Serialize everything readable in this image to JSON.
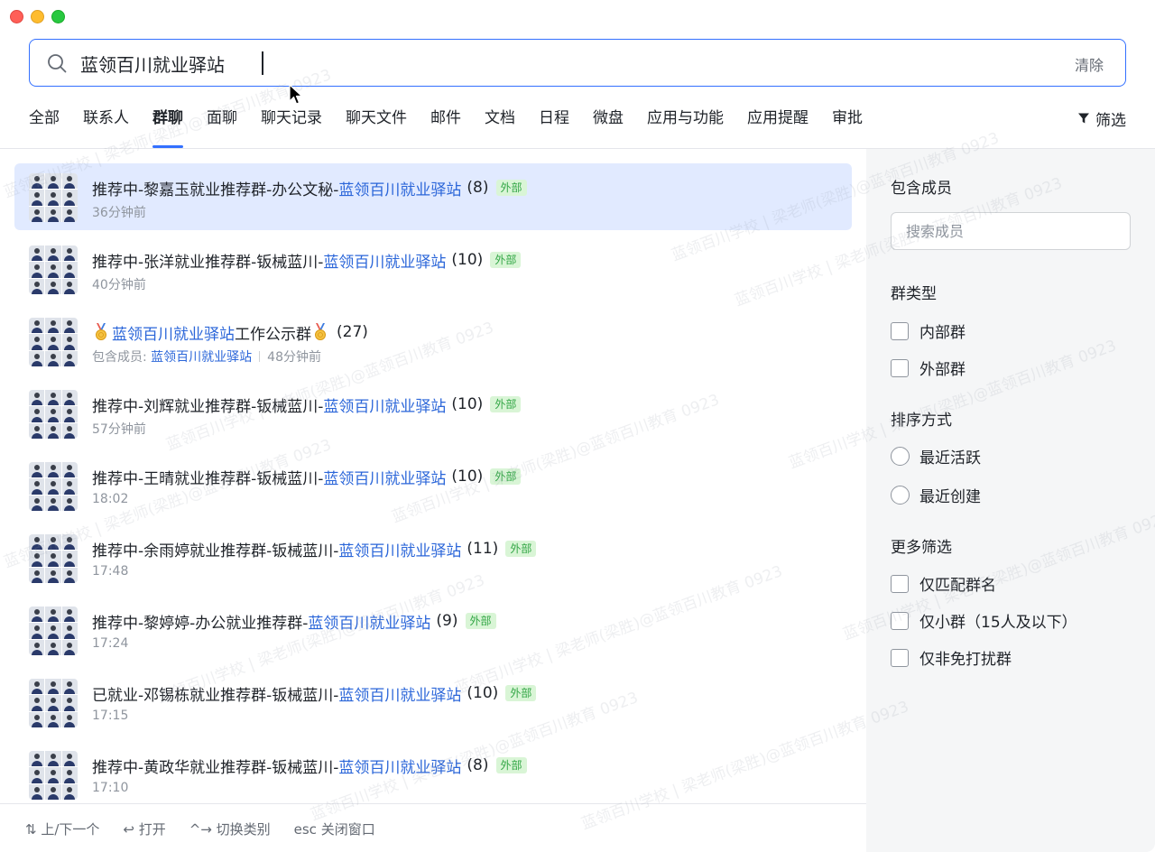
{
  "window": {
    "controls": [
      "close",
      "minimize",
      "maximize"
    ]
  },
  "search": {
    "value": "蓝领百川就业驿站",
    "clear_label": "清除"
  },
  "tabs": [
    {
      "label": "全部"
    },
    {
      "label": "联系人"
    },
    {
      "label": "群聊",
      "active": true
    },
    {
      "label": "面聊"
    },
    {
      "label": "聊天记录"
    },
    {
      "label": "聊天文件"
    },
    {
      "label": "邮件"
    },
    {
      "label": "文档"
    },
    {
      "label": "日程"
    },
    {
      "label": "微盘"
    },
    {
      "label": "应用与功能"
    },
    {
      "label": "应用提醒"
    },
    {
      "label": "审批"
    }
  ],
  "filter_label": "筛选",
  "results": [
    {
      "prefix": "推荐中-黎嘉玉就业推荐群-办公文秘-",
      "highlight": "蓝领百川就业驿站",
      "suffix": "",
      "count": "(8)",
      "badge": "外部",
      "time": "36分钟前",
      "selected": true
    },
    {
      "prefix": "推荐中-张洋就业推荐群-钣械蓝川-",
      "highlight": "蓝领百川就业驿站",
      "suffix": "",
      "count": "(10)",
      "badge": "外部",
      "time": "40分钟前"
    },
    {
      "prefix": "",
      "highlight": "蓝领百川就业驿站",
      "suffix": "工作公示群",
      "count": "(27)",
      "badge": "",
      "medal": true,
      "members_label": "包含成员: ",
      "members_value": "蓝领百川就业驿站",
      "time": "48分钟前"
    },
    {
      "prefix": "推荐中-刘辉就业推荐群-钣械蓝川-",
      "highlight": "蓝领百川就业驿站",
      "suffix": "",
      "count": "(10)",
      "badge": "外部",
      "time": "57分钟前"
    },
    {
      "prefix": "推荐中-王晴就业推荐群-钣械蓝川-",
      "highlight": "蓝领百川就业驿站",
      "suffix": "",
      "count": "(10)",
      "badge": "外部",
      "time": "18:02"
    },
    {
      "prefix": "推荐中-余雨婷就业推荐群-钣械蓝川-",
      "highlight": "蓝领百川就业驿站",
      "suffix": "",
      "count": "(11)",
      "badge": "外部",
      "time": "17:48"
    },
    {
      "prefix": "推荐中-黎婷婷-办公就业推荐群-",
      "highlight": "蓝领百川就业驿站",
      "suffix": "",
      "count": "(9)",
      "badge": "外部",
      "time": "17:24"
    },
    {
      "prefix": "已就业-邓锡栋就业推荐群-钣械蓝川-",
      "highlight": "蓝领百川就业驿站",
      "suffix": "",
      "count": "(10)",
      "badge": "外部",
      "time": "17:15"
    },
    {
      "prefix": "推荐中-黄政华就业推荐群-钣械蓝川-",
      "highlight": "蓝领百川就业驿站",
      "suffix": "",
      "count": "(8)",
      "badge": "外部",
      "time": "17:10"
    }
  ],
  "panel": {
    "members_heading": "包含成员",
    "members_placeholder": "搜索成员",
    "group_type_heading": "群类型",
    "group_type_options": [
      "内部群",
      "外部群"
    ],
    "sort_heading": "排序方式",
    "sort_options": [
      "最近活跃",
      "最近创建"
    ],
    "more_heading": "更多筛选",
    "more_options": [
      "仅匹配群名",
      "仅小群（15人及以下）",
      "仅非免打扰群"
    ]
  },
  "footer": {
    "nav": "⇅ 上/下一个",
    "open": "↩ 打开",
    "switch": "^→ 切换类别",
    "close": "esc 关闭窗口"
  },
  "watermark_text": "蓝领百川学校 | 梁老师(梁胜)@蓝领百川教育 0923",
  "colors": {
    "accent": "#3370ff",
    "highlight_text": "#2b66d9",
    "selected_row": "#e1eaff",
    "badge_text": "#32a645",
    "badge_bg": "#d9f5d6",
    "panel_bg": "#f5f6f7"
  }
}
